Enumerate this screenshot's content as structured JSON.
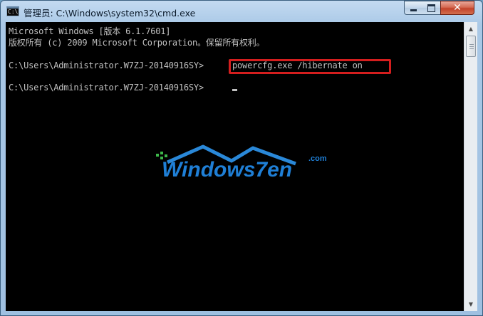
{
  "window": {
    "title": "管理员: C:\\Windows\\system32\\cmd.exe",
    "icon_glyph": "C:\\",
    "controls": {
      "minimize": "minimize-icon",
      "maximize": "maximize-icon",
      "close": "close-icon"
    }
  },
  "console": {
    "lines": [
      "Microsoft Windows [版本 6.1.7601]",
      "版权所有 (c) 2009 Microsoft Corporation。保留所有权利。",
      "C:\\Users\\Administrator.W7ZJ-20140916SY>",
      "C:\\Users\\Administrator.W7ZJ-20140916SY>"
    ],
    "highlighted_command": "powercfg.exe /hibernate on",
    "highlight_color": "#d41e1e",
    "text_color": "#c0c0c0",
    "background": "#000000"
  },
  "watermark": {
    "text": "Windows7en",
    "suffix": ".com",
    "color": "#1f7fd6"
  }
}
